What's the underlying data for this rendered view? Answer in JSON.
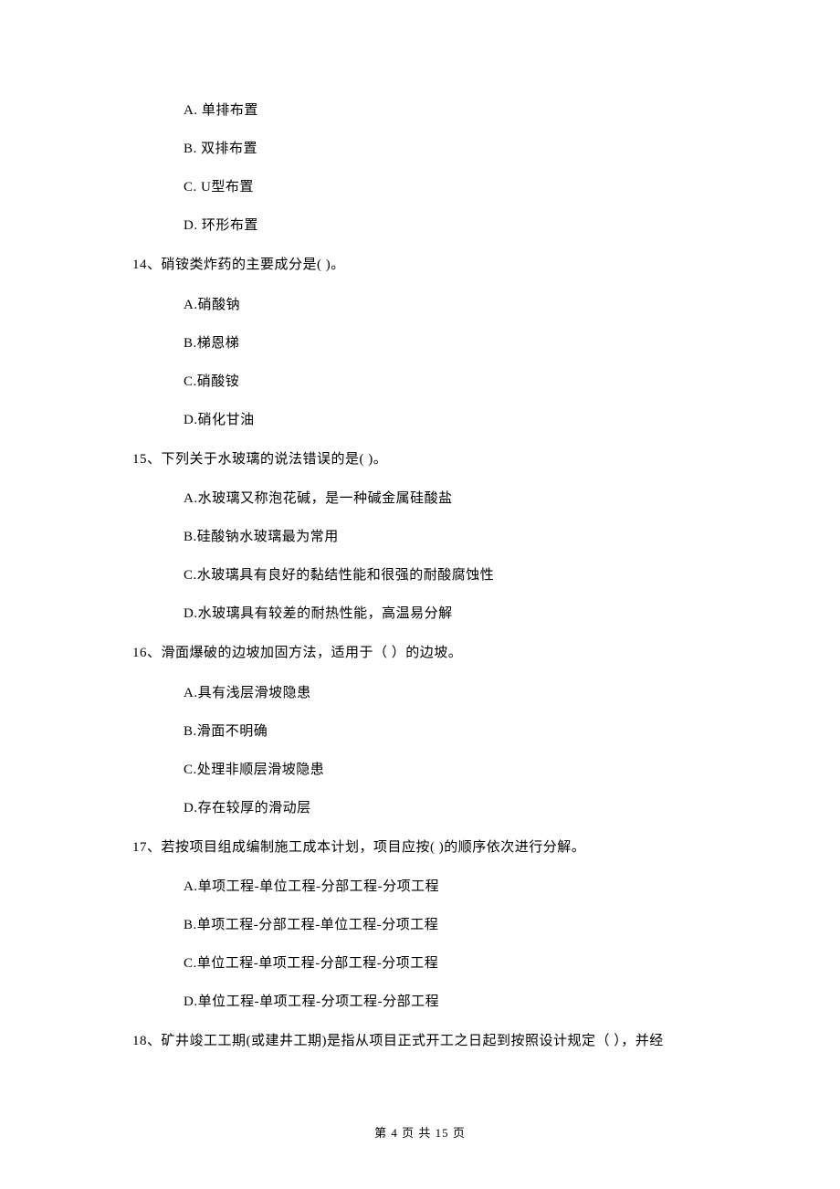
{
  "prev_options": {
    "a": "A.  单排布置",
    "b": "B.  双排布置",
    "c": "C.  U型布置",
    "d": "D.  环形布置"
  },
  "q14": {
    "stem": "14、硝铵类炸药的主要成分是(      )。",
    "a": "A.硝酸钠",
    "b": "B.梯恩梯",
    "c": "C.硝酸铵",
    "d": "D.硝化甘油"
  },
  "q15": {
    "stem": "15、下列关于水玻璃的说法错误的是(      )。",
    "a": "A.水玻璃又称泡花碱，是一种碱金属硅酸盐",
    "b": "B.硅酸钠水玻璃最为常用",
    "c": "C.水玻璃具有良好的黏结性能和很强的耐酸腐蚀性",
    "d": "D.水玻璃具有较差的耐热性能，高温易分解"
  },
  "q16": {
    "stem": "16、滑面爆破的边坡加固方法，适用于（     ）的边坡。",
    "a": "A.具有浅层滑坡隐患",
    "b": "B.滑面不明确",
    "c": "C.处理非顺层滑坡隐患",
    "d": "D.存在较厚的滑动层"
  },
  "q17": {
    "stem": "17、若按项目组成编制施工成本计划，项目应按(      )的顺序依次进行分解。",
    "a": "A.单项工程-单位工程-分部工程-分项工程",
    "b": "B.单项工程-分部工程-单位工程-分项工程",
    "c": "C.单位工程-单项工程-分部工程-分项工程",
    "d": "D.单位工程-单项工程-分项工程-分部工程"
  },
  "q18": {
    "stem": "18、矿井竣工工期(或建井工期)是指从项目正式开工之日起到按照设计规定（     ），并经"
  },
  "footer": "第  4  页  共  15  页"
}
